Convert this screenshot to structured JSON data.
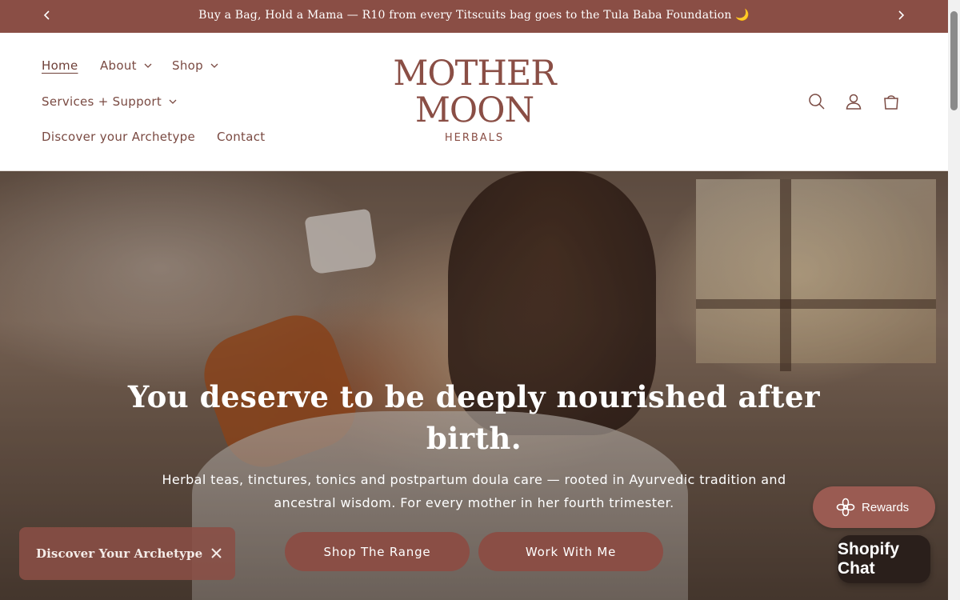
{
  "announcement": {
    "text": "Buy a Bag, Hold a Mama — R10 from every Titscuits bag goes to the Tula Baba Foundation 🌙",
    "prev_icon": "chevron-left-icon",
    "next_icon": "chevron-right-icon"
  },
  "nav": {
    "home": "Home",
    "about": "About",
    "shop": "Shop",
    "services": "Services + Support",
    "discover": "Discover your Archetype",
    "contact": "Contact"
  },
  "logo": {
    "line1": "MOTHER",
    "line2": "MOON",
    "line3": "HERBALS"
  },
  "header_icons": [
    "search-icon",
    "account-icon",
    "cart-icon"
  ],
  "hero": {
    "title": "You deserve to be deeply nourished after birth.",
    "subtitle": "Herbal teas, tinctures, tonics and postpartum doula care — rooted in Ayurvedic tradition and ancestral wisdom. For every mother in her fourth trimester.",
    "button_shop": "Shop The Range",
    "button_work": "Work With Me"
  },
  "widgets": {
    "archetype_label": "Discover Your Archetype",
    "rewards_label": "Rewards",
    "chat_label": "Shopify Chat"
  },
  "colors": {
    "brand": "#8a4e45",
    "nav_text": "#7a4a42",
    "chat_bg": "#2a1f1b"
  }
}
